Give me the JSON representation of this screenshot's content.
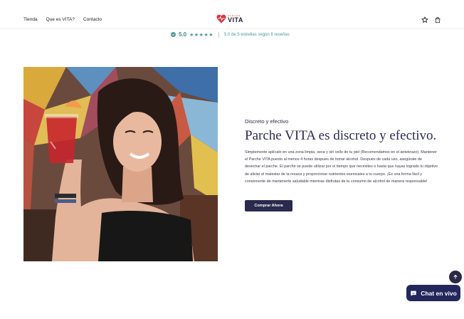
{
  "header": {
    "nav": [
      "Tienda",
      "Que es VITA?",
      "Contacto"
    ],
    "logo_small": "PARCHE",
    "logo_big": "VITA",
    "icons": [
      "star-icon",
      "bag-icon"
    ]
  },
  "rating": {
    "score": "5.0",
    "stars": "★★★★★",
    "text": "5.0 de 5 estrellas según 8 reseñas"
  },
  "section": {
    "eyebrow": "Discreto y efectivo",
    "title": "Parche VITA es discreto y efectivo.",
    "body": "Simplemente aplícalo en una zona limpia, seca y sin vello de tu piel (Recomendamos en el antebrazo). Mantener el Parche VITA puesto al menos 4 horas despues de tomar alcohol. Después de cada uso, asegúrate de desechar el parche. El parche se puede utilizar por el tiempo que necesites o hasta que hayas logrado tu objetivo de aliviar el malestar de la resaca y proporcionar nutrientes esenciales a tu cuerpo. ¡Es una forma fácil y conveniente de mantenerte saludable mientras disfrutas de tu consumo de alcohol de manera responsable!",
    "cta_label": "Comprar Ahora"
  },
  "chat": {
    "label": "Chat en vivo"
  },
  "colors": {
    "accent": "#2a2a4e",
    "rating": "#4b9a98",
    "chat": "#23285c",
    "logo_heart": "#e0343c"
  }
}
